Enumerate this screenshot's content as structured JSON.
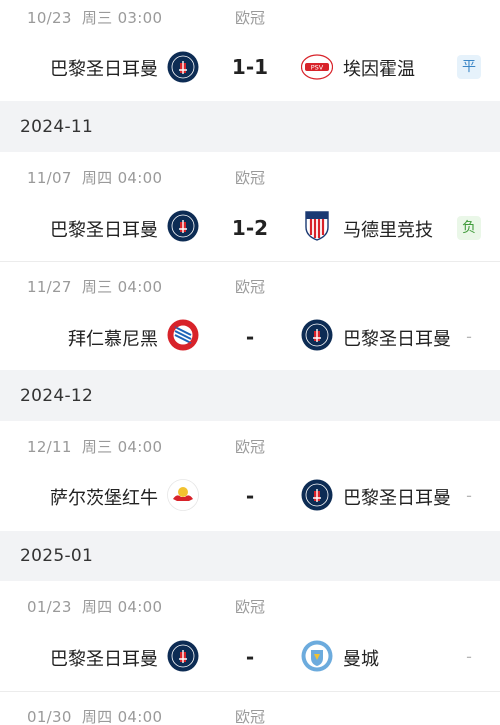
{
  "groups": [
    {
      "month": ""
    },
    {
      "month": "2024-11"
    },
    {
      "month": "2024-12"
    },
    {
      "month": "2025-01"
    }
  ],
  "matches": [
    {
      "date": "10/23",
      "weekday": "周三",
      "time": "03:00",
      "competition": "欧冠",
      "home": "巴黎圣日耳曼",
      "home_logo": "psg-logo",
      "score": "1-1",
      "away": "埃因霍温",
      "away_logo": "psv-logo",
      "result": "平"
    },
    {
      "date": "11/07",
      "weekday": "周四",
      "time": "04:00",
      "competition": "欧冠",
      "home": "巴黎圣日耳曼",
      "home_logo": "psg-logo",
      "score": "1-2",
      "away": "马德里竞技",
      "away_logo": "atletico-logo",
      "result": "负"
    },
    {
      "date": "11/27",
      "weekday": "周三",
      "time": "04:00",
      "competition": "欧冠",
      "home": "拜仁慕尼黑",
      "home_logo": "bayern-logo",
      "score": "-",
      "away": "巴黎圣日耳曼",
      "away_logo": "psg-logo",
      "result": "-"
    },
    {
      "date": "12/11",
      "weekday": "周三",
      "time": "04:00",
      "competition": "欧冠",
      "home": "萨尔茨堡红牛",
      "home_logo": "salzburg-logo",
      "score": "-",
      "away": "巴黎圣日耳曼",
      "away_logo": "psg-logo",
      "result": "-"
    },
    {
      "date": "01/23",
      "weekday": "周四",
      "time": "04:00",
      "competition": "欧冠",
      "home": "巴黎圣日耳曼",
      "home_logo": "psg-logo",
      "score": "-",
      "away": "曼城",
      "away_logo": "mancity-logo",
      "result": "-"
    },
    {
      "date": "01/30",
      "weekday": "周四",
      "time": "04:00",
      "competition": "欧冠"
    }
  ],
  "colors": {
    "draw": "#3b86c6",
    "lose": "#3f9b3a",
    "psg": "#0d2c54",
    "psg_red": "#d8232a"
  }
}
